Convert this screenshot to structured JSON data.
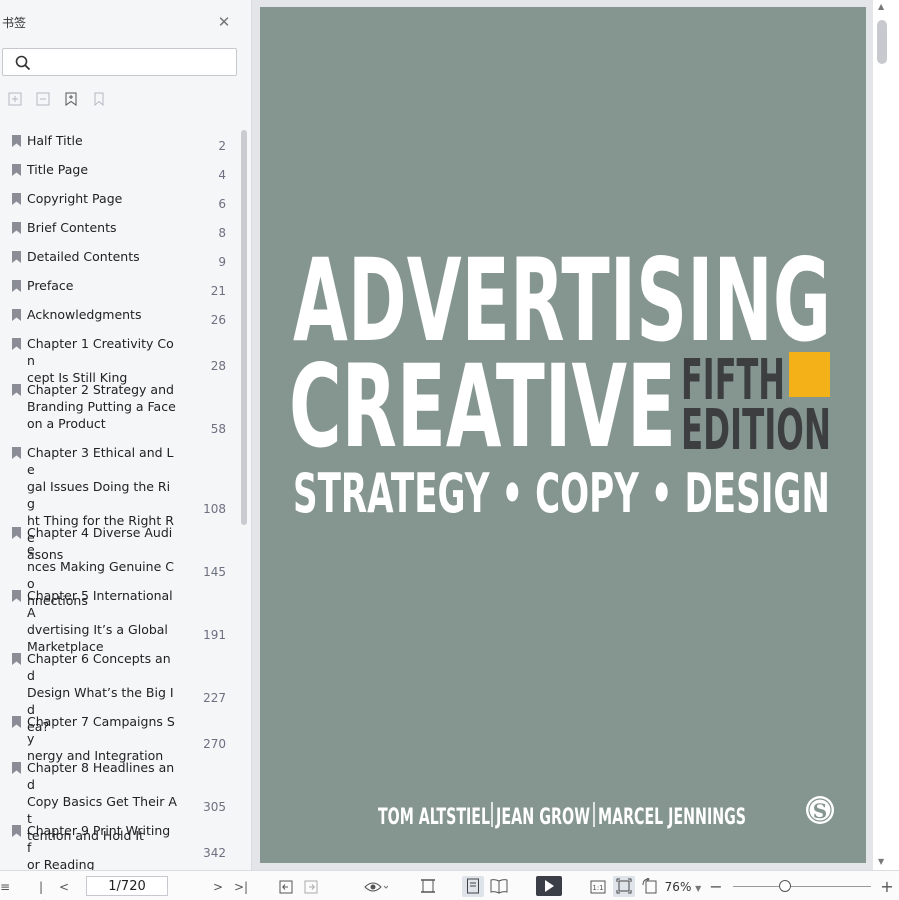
{
  "sidebar": {
    "title": "书签",
    "search_placeholder": "",
    "bookmarks": [
      {
        "title": "Half Title",
        "page": "2"
      },
      {
        "title": "Title Page",
        "page": "4"
      },
      {
        "title": "Copyright Page",
        "page": "6"
      },
      {
        "title": "Brief Contents",
        "page": "8"
      },
      {
        "title": "Detailed Contents",
        "page": "9"
      },
      {
        "title": "Preface",
        "page": "21"
      },
      {
        "title": "Acknowledgments",
        "page": "26"
      },
      {
        "title": "Chapter 1 Creativity Con\ncept Is Still King",
        "page": "28"
      },
      {
        "title": "Chapter 2 Strategy and\nBranding Putting a Face\non a Product",
        "page": "58"
      },
      {
        "title": "Chapter 3 Ethical and Le\ngal Issues Doing the Rig\nht Thing for the Right Re\nasons",
        "page": "108"
      },
      {
        "title": "Chapter 4 Diverse Audie\nnces Making Genuine Co\nnnections",
        "page": "145"
      },
      {
        "title": "Chapter 5 International A\ndvertising It’s a Global\nMarketplace",
        "page": "191"
      },
      {
        "title": "Chapter 6 Concepts and\nDesign What’s the Big Id\nea?",
        "page": "227"
      },
      {
        "title": "Chapter 7 Campaigns Sy\nnergy and Integration",
        "page": "270"
      },
      {
        "title": "Chapter 8 Headlines and\nCopy Basics Get Their At\ntention and Hold It",
        "page": "305"
      },
      {
        "title": "Chapter 9 Print Writing f\nor Reading",
        "page": "342"
      }
    ]
  },
  "cover": {
    "line1": "ADVERTISING",
    "line2": "CREATIVE",
    "edition1": "FIFTH",
    "edition2": "EDITION",
    "subtitle": "STRATEGY • COPY • DESIGN",
    "author1": "TOM ALTSTIEL",
    "author2": "JEAN GROW",
    "author3": "MARCEL JENNINGS",
    "publisher_logo": "S",
    "colors": {
      "background": "#859590",
      "title": "#ffffff",
      "edition": "#3d3e40",
      "accent": "#f4b218"
    }
  },
  "toolbar": {
    "page_value": "1/720",
    "zoom": "76%"
  }
}
